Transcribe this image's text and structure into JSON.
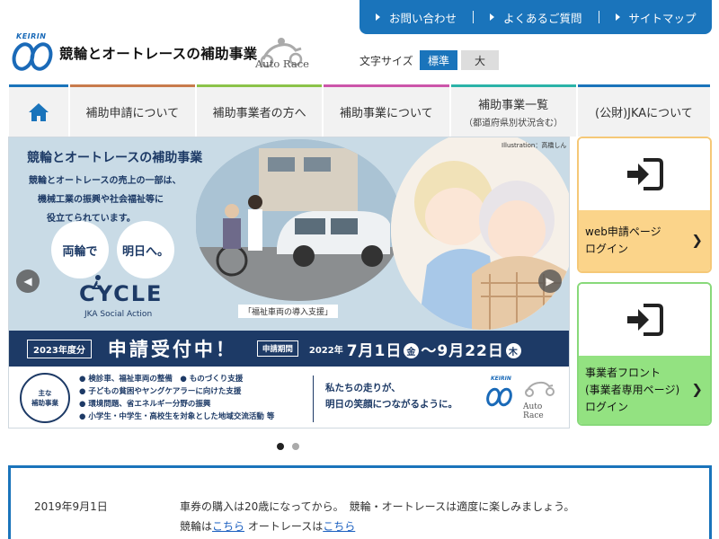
{
  "utility_links": [
    "お問い合わせ",
    "よくあるご質問",
    "サイトマップ"
  ],
  "logo": {
    "keirin": "KEIRIN"
  },
  "site_title": "競輪とオートレースの補助事業",
  "autorace_logo": "Auto Race",
  "font_size": {
    "label": "文字サイズ",
    "standard": "標準",
    "large": "大"
  },
  "nav": {
    "home_icon": "home-icon",
    "items": [
      {
        "label": "補助申請について"
      },
      {
        "label": "補助事業者の方へ"
      },
      {
        "label": "補助事業について"
      },
      {
        "label": "補助事業一覧",
        "sub": "（都道府県別状況含む）"
      },
      {
        "label": "(公財)JKAについて"
      }
    ]
  },
  "hero": {
    "title": "競輪とオートレースの補助事業",
    "desc": [
      "競輪とオートレースの売上の一部は、",
      "機械工業の振興や社会福祉等に",
      "役立てられています。"
    ],
    "bubble1": "両輪で",
    "bubble2": "明日へ。",
    "cycle": "CYCLE",
    "cycle_sub": "JKA Social Action",
    "illus_credit": "Illustration：高橋しん",
    "photo_caption": "「福祉車両の導入支援」",
    "year": "2023年度分",
    "accepting": "申請受付中！",
    "period_label": "申請期間",
    "period_year": "2022年",
    "start_date": "7月1日",
    "start_day": "金",
    "tilde": "〜",
    "end_date": "9月22日",
    "end_day": "木",
    "main_badge": [
      "主な",
      "補助事業"
    ],
    "bullets": [
      "検診車、福祉車両の整備　● ものづくり支援",
      "子どもの貧困やヤングケアラーに向けた支援",
      "環境問題、省エネルギー分野の振興",
      "小学生・中学生・高校生を対象とした地域交流活動 等"
    ],
    "message": [
      "私たちの走りが、",
      "明日の笑顔につながるように。"
    ],
    "keirin_small": "KEIRIN",
    "autorace_small": "Auto Race"
  },
  "side": {
    "web_label": [
      "web申請ページ",
      "ログイン"
    ],
    "biz_label": [
      "事業者フロント",
      "(事業者専用ページ)",
      "ログイン"
    ]
  },
  "news": {
    "date": "2019年9月1日",
    "text": "車券の購入は20歳になってから。　競輪・オートレースは適度に楽しみましょう。",
    "keirin_prefix": "競輪は",
    "keirin_link": "こちら",
    "autorace_prefix": " オートレースは",
    "autorace_link": "こちら"
  }
}
